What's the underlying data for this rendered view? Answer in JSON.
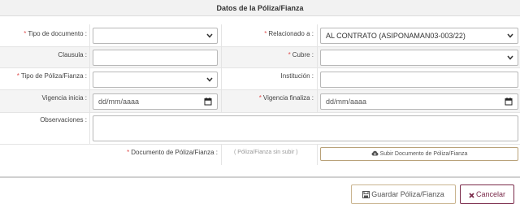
{
  "header": {
    "title": "Datos de la Póliza/Fianza"
  },
  "form": {
    "tipo_documento": {
      "label": "Tipo de documento :",
      "required": "*",
      "value": ""
    },
    "relacionado": {
      "label": "Relacionado a :",
      "required": "*",
      "value": "AL CONTRATO (ASIPONAMAN03-003/22)"
    },
    "clausula": {
      "label": "Clausula :",
      "value": ""
    },
    "cubre": {
      "label": "Cubre :",
      "required": "*",
      "value": ""
    },
    "tipo_poliza": {
      "label": "Tipo de Póliza/Fianza :",
      "required": "*",
      "value": ""
    },
    "institucion": {
      "label": "Institución :",
      "value": ""
    },
    "vigencia_inicia": {
      "label": "Vigencia inicia :",
      "placeholder": "dd/mm/aaaa"
    },
    "vigencia_finaliza": {
      "label": "Vigencia finaliza :",
      "required": "*",
      "placeholder": "dd/mm/aaaa"
    },
    "observaciones": {
      "label": "Observaciones :",
      "value": ""
    },
    "documento": {
      "label": "Documento de Póliza/Fianza :",
      "required": "*",
      "status": "( Póliza/Fianza sin subir )",
      "upload_label": "Subir Documento de Póliza/Fianza"
    }
  },
  "footer": {
    "save_label": "Guardar Póliza/Fianza",
    "cancel_label": "Cancelar"
  },
  "icons": {
    "select_arrow": "chevron-down-icon",
    "calendar": "calendar-icon",
    "upload": "cloud-upload-icon",
    "save": "save-icon",
    "cancel": "close-icon"
  },
  "colors": {
    "required": "#e05050",
    "upload_border": "#b9a27a",
    "save_border": "#c9b48f",
    "cancel": "#7a2a4a"
  }
}
